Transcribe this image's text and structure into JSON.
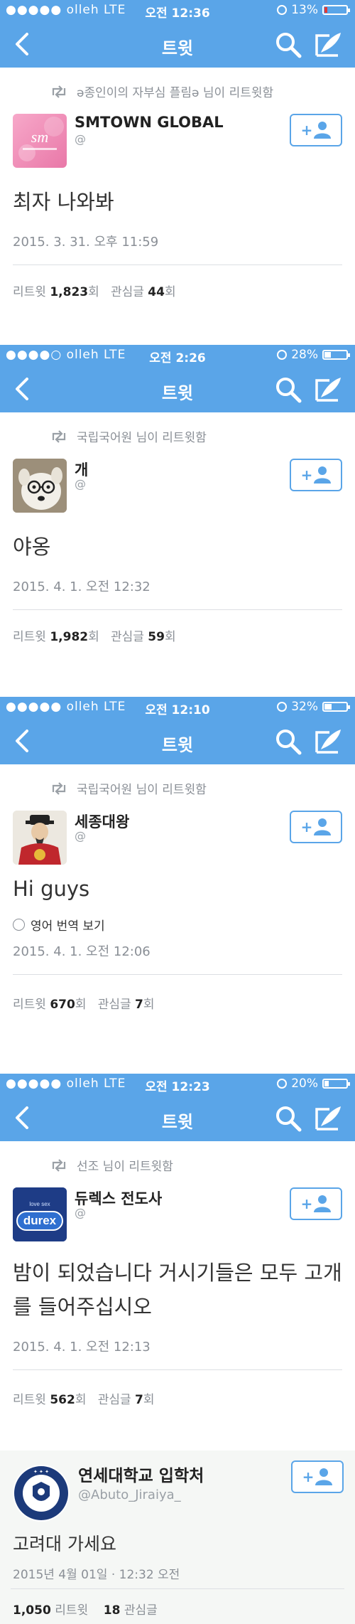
{
  "colors": {
    "twitter_blue": "#5aa5e8",
    "battery_low": "#e53935"
  },
  "screens": [
    {
      "status": {
        "carrier": "●●●●● olleh  LTE",
        "time": "오전 12:36",
        "battery": "13%",
        "battery_level": 0.13
      },
      "nav": {
        "title": "트윗"
      },
      "retweet_line": "ə종인이의 자부심 플림ə 님이 리트윗함",
      "account": {
        "name": "SMTOWN GLOBAL",
        "handle": "@",
        "avatar": "smtown-logo"
      },
      "text": "최자 나와봐",
      "date": "2015. 3. 31. 오후 11:59",
      "stats": {
        "rt_label": "리트윗",
        "rt_count": "1,823",
        "rt_unit": "회",
        "fav_label": "관심글",
        "fav_count": "44",
        "fav_unit": "회"
      }
    },
    {
      "status": {
        "carrier": "●●●●○ olleh  LTE",
        "time": "오전 2:26",
        "battery": "28%",
        "battery_level": 0.28
      },
      "nav": {
        "title": "트윗"
      },
      "retweet_line": "국립국어원 님이 리트윗함",
      "account": {
        "name": "개",
        "handle": "@",
        "avatar": "dog-photo"
      },
      "text": "야옹",
      "date": "2015. 4. 1. 오전 12:32",
      "stats": {
        "rt_label": "리트윗",
        "rt_count": "1,982",
        "rt_unit": "회",
        "fav_label": "관심글",
        "fav_count": "59",
        "fav_unit": "회"
      }
    },
    {
      "status": {
        "carrier": "●●●●● olleh  LTE",
        "time": "오전 12:10",
        "battery": "32%",
        "battery_level": 0.32
      },
      "nav": {
        "title": "트윗"
      },
      "retweet_line": "국립국어원 님이 리트윗함",
      "account": {
        "name": "세종대왕",
        "handle": "@",
        "avatar": "king-portrait"
      },
      "text": "Hi guys",
      "translate": "영어 번역 보기",
      "date": "2015. 4. 1. 오전 12:06",
      "stats": {
        "rt_label": "리트윗",
        "rt_count": "670",
        "rt_unit": "회",
        "fav_label": "관심글",
        "fav_count": "7",
        "fav_unit": "회"
      }
    },
    {
      "status": {
        "carrier": "●●●●● olleh  LTE",
        "time": "오전 12:23",
        "battery": "20%",
        "battery_level": 0.2
      },
      "nav": {
        "title": "트윗"
      },
      "retweet_line": "선조 님이 리트윗함",
      "account": {
        "name": "듀렉스 전도사",
        "handle": "@",
        "avatar": "durex-logo",
        "logo_text": "durex",
        "logo_tag": "love sex"
      },
      "text": "밤이 되었습니다 거시기들은 모두 고개를 들어주십시오",
      "date": "2015. 4. 1. 오전 12:13",
      "stats": {
        "rt_label": "리트윗",
        "rt_count": "562",
        "rt_unit": "회",
        "fav_label": "관심글",
        "fav_count": "7",
        "fav_unit": "회"
      }
    }
  ],
  "final": {
    "account": {
      "name": "연세대학교 입학처",
      "handle": "@Abuto_Jiraiya_",
      "avatar": "yonsei-seal"
    },
    "text": "고려대 가세요",
    "date": "2015년 4월 01일 · 12:32 오전",
    "stats": {
      "rt_count": "1,050",
      "rt_label": "리트윗",
      "fav_count": "18",
      "fav_label": "관심글"
    }
  }
}
